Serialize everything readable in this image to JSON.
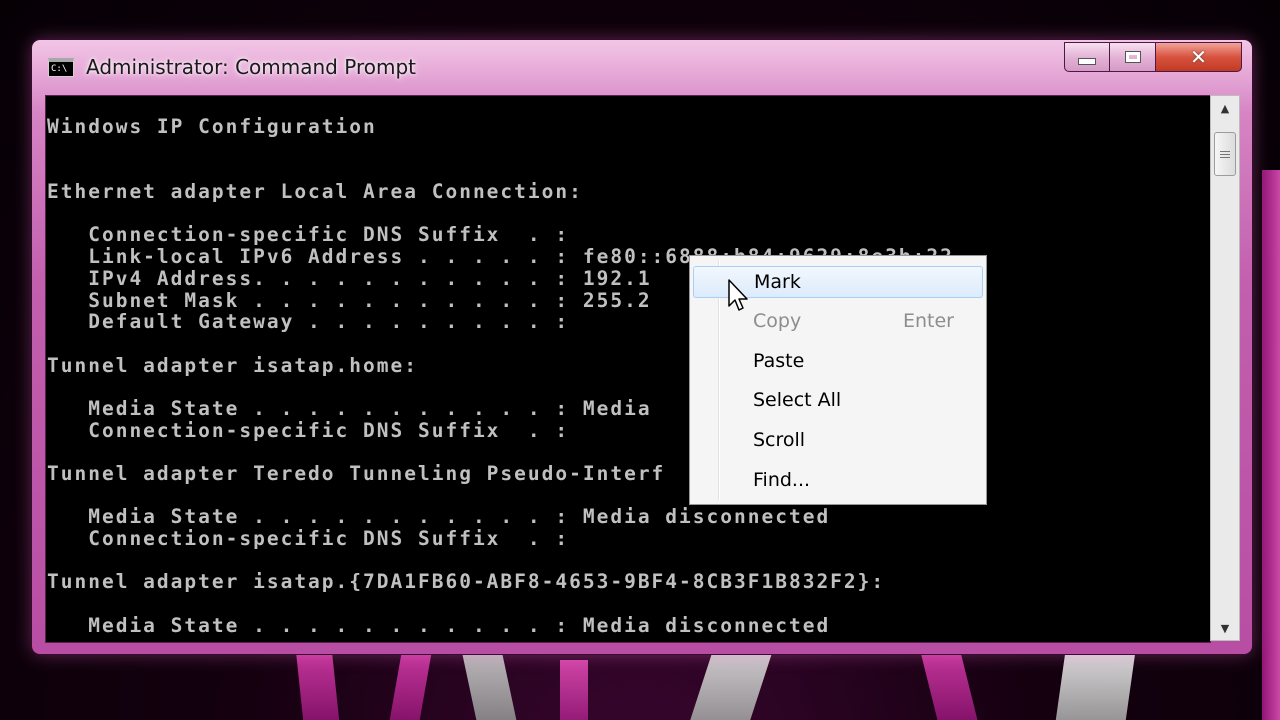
{
  "window": {
    "title": "Administrator: Command Prompt",
    "icon_text": "C:\\"
  },
  "caption_buttons": {
    "minimize": "minimize-icon",
    "maximize": "maximize-icon",
    "close": "close-icon"
  },
  "console": {
    "lines": [
      "Windows IP Configuration",
      "",
      "",
      "Ethernet adapter Local Area Connection:",
      "",
      "   Connection-specific DNS Suffix  . :",
      "   Link-local IPv6 Address . . . . . : fe80::6888:b84:9629:8e3b:22",
      "   IPv4 Address. . . . . . . . . . . : 192.1",
      "   Subnet Mask . . . . . . . . . . . : 255.2",
      "   Default Gateway . . . . . . . . . :",
      "",
      "Tunnel adapter isatap.home:",
      "",
      "   Media State . . . . . . . . . . . : Media",
      "   Connection-specific DNS Suffix  . :",
      "",
      "Tunnel adapter Teredo Tunneling Pseudo-Interf",
      "",
      "   Media State . . . . . . . . . . . : Media disconnected",
      "   Connection-specific DNS Suffix  . :",
      "",
      "Tunnel adapter isatap.{7DA1FB60-ABF8-4653-9BF4-8CB3F1B832F2}:",
      "",
      "   Media State . . . . . . . . . . . : Media disconnected"
    ]
  },
  "context_menu": {
    "items": [
      {
        "label": "Mark",
        "shortcut": "",
        "state": "hover"
      },
      {
        "label": "Copy",
        "shortcut": "Enter",
        "state": "disabled"
      },
      {
        "label": "Paste",
        "shortcut": "",
        "state": "normal"
      },
      {
        "label": "Select All",
        "shortcut": "",
        "state": "normal"
      },
      {
        "label": "Scroll",
        "shortcut": "",
        "state": "normal"
      },
      {
        "label": "Find...",
        "shortcut": "",
        "state": "normal"
      }
    ]
  },
  "scrollbar": {
    "up_icon": "scroll-up-arrow-icon",
    "down_icon": "scroll-down-arrow-icon",
    "up_glyph": "▲",
    "down_glyph": "▼"
  },
  "colors": {
    "console_bg": "#000000",
    "console_fg": "#c0c0c0",
    "frame_accent": "#c25fae",
    "menu_hover": "#dcebfc"
  }
}
